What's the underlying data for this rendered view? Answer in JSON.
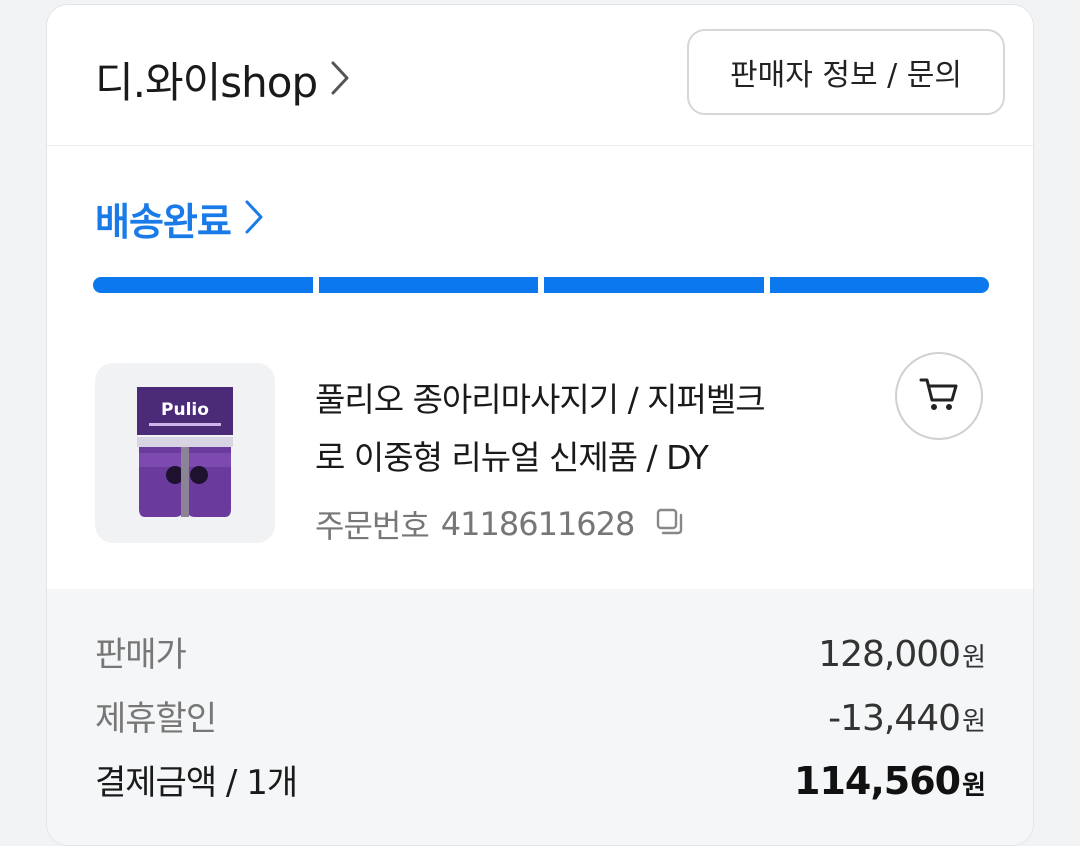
{
  "header": {
    "shop_name": "디.와이shop",
    "seller_button": "판매자 정보 / 문의"
  },
  "delivery": {
    "status": "배송완료",
    "progress_steps_completed": 4,
    "progress_steps_total": 4,
    "accent_color": "#0c78ee"
  },
  "product": {
    "name_line1": "풀리오 종아리마사지기 / 지퍼벨크",
    "name_line2": "로 이중형 리뉴얼 신제품 / DY",
    "thumbnail_brand": "Pulio",
    "order_label": "주문번호",
    "order_number": "4118611628",
    "copy_icon": "copy-icon",
    "cart_icon": "cart-icon"
  },
  "summary": {
    "rows": [
      {
        "label": "판매가",
        "amount": "128,000",
        "unit": "원"
      },
      {
        "label": "제휴할인",
        "amount": "-13,440",
        "unit": "원"
      },
      {
        "label": "결제금액 / 1개",
        "amount": "114,560",
        "unit": "원"
      }
    ]
  }
}
